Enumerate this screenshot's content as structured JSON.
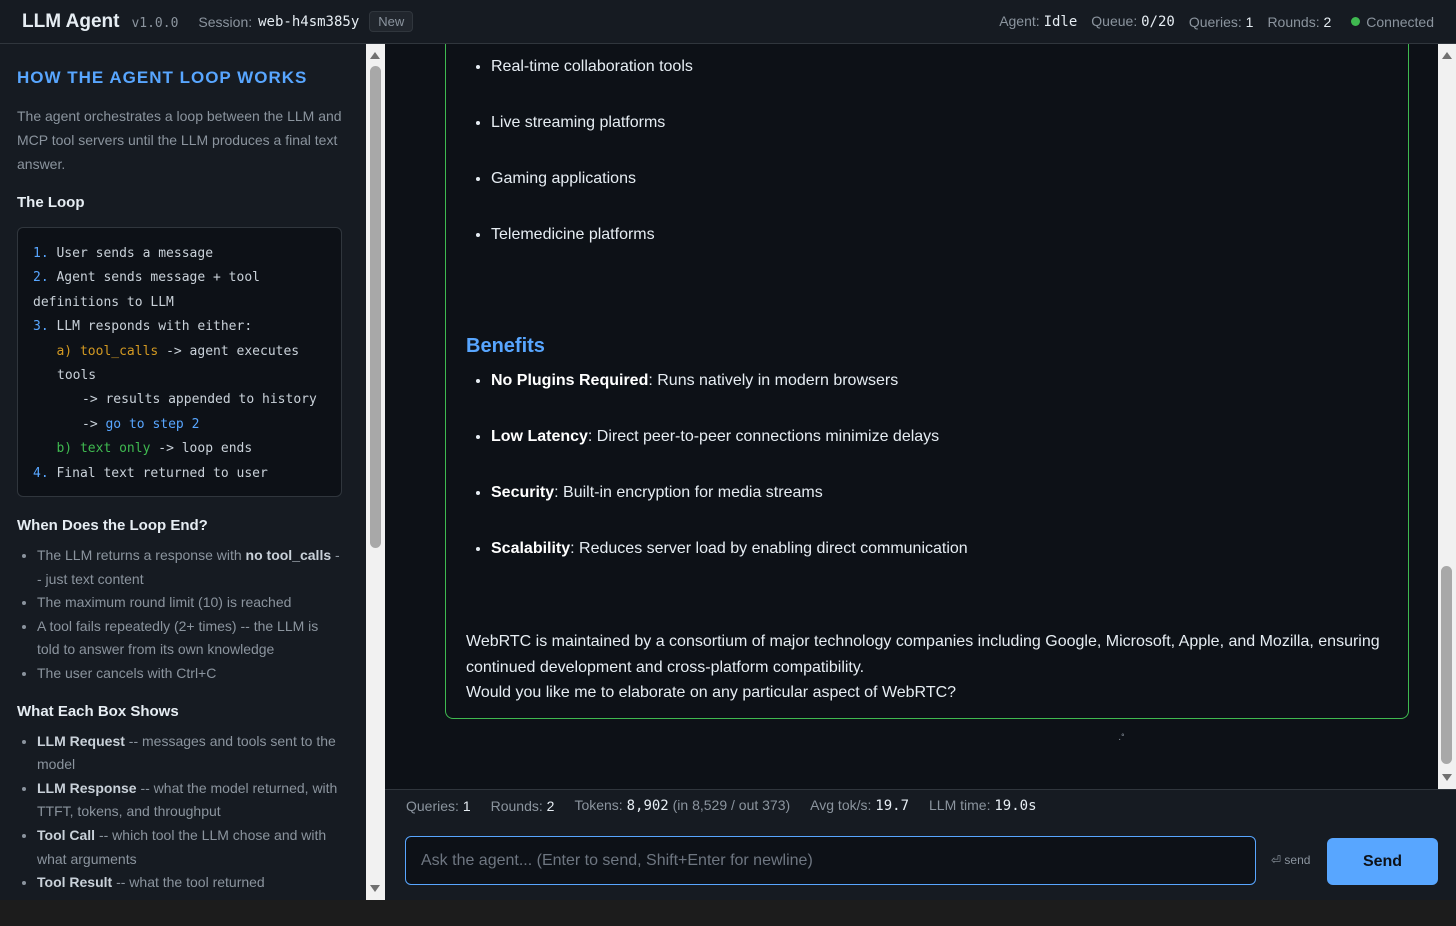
{
  "header": {
    "brand": "LLM Agent",
    "version": "v1.0.0",
    "session_label": "Session:",
    "session_id": "web-h4sm385y",
    "new_label": "New",
    "agent_label": "Agent:",
    "agent_value": "Idle",
    "queue_label": "Queue:",
    "queue_value": "0/20",
    "queries_label": "Queries:",
    "queries_value": "1",
    "rounds_label": "Rounds:",
    "rounds_value": "2",
    "connection": "Connected"
  },
  "sidebar": {
    "title": "How the Agent Loop Works",
    "intro": "The agent orchestrates a loop between the LLM and MCP tool servers until the LLM produces a final text answer.",
    "loop_heading": "The Loop",
    "code": {
      "l1_num": "1.",
      "l1": " User sends a message",
      "l2_num": "2.",
      "l2": " Agent sends message + tool definitions to LLM",
      "l3_num": "3.",
      "l3": " LLM responds with either:",
      "l4_a": "a)",
      "l4_tc": "tool_calls",
      "l4_rest": " -> agent executes tools",
      "l5": "-> results appended to history",
      "l6_arrow": "->",
      "l6_go": "go to step 2",
      "l7_b": "b)",
      "l7_text": "text only",
      "l7_rest": " -> loop ends",
      "l8_num": "4.",
      "l8": " Final text returned to user"
    },
    "end_heading": "When Does the Loop End?",
    "end_items": {
      "i1_a": "The LLM returns a response with ",
      "i1_b": "no tool_calls",
      "i1_c": " -- just text content",
      "i2": "The maximum round limit (10) is reached",
      "i3": "A tool fails repeatedly (2+ times) -- the LLM is told to answer from its own knowledge",
      "i4": "The user cancels with Ctrl+C"
    },
    "box_heading": "What Each Box Shows",
    "box_items": {
      "b1_t": "LLM Request",
      "b1_d": " -- messages and tools sent to the model",
      "b2_t": "LLM Response",
      "b2_d": " -- what the model returned, with TTFT, tokens, and throughput",
      "b3_t": "Tool Call",
      "b3_d": " -- which tool the LLM chose and with what arguments",
      "b4_t": "Tool Result",
      "b4_d": " -- what the tool returned"
    }
  },
  "message": {
    "use_cases": [
      "Real-time collaboration tools",
      "Live streaming platforms",
      "Gaming applications",
      "Telemedicine platforms"
    ],
    "benefits_heading": "Benefits",
    "benefits": [
      {
        "title": "No Plugins Required",
        "desc": ": Runs natively in modern browsers"
      },
      {
        "title": "Low Latency",
        "desc": ": Direct peer-to-peer connections minimize delays"
      },
      {
        "title": "Security",
        "desc": ": Built-in encryption for media streams"
      },
      {
        "title": "Scalability",
        "desc": ": Reduces server load by enabling direct communication"
      }
    ],
    "closing_1": "WebRTC is maintained by a consortium of major technology companies including Google, Microsoft, Apple, and Mozilla, ensuring continued development and cross-platform compatibility.",
    "closing_2": "Would you like me to elaborate on any particular aspect of WebRTC?"
  },
  "stats": {
    "queries_label": "Queries:",
    "queries_value": "1",
    "rounds_label": "Rounds:",
    "rounds_value": "2",
    "tokens_label": "Tokens:",
    "tokens_value": "8,902",
    "tokens_detail": "(in 8,529 / out 373)",
    "avg_label": "Avg tok/s:",
    "avg_value": "19.7",
    "llm_time_label": "LLM time:",
    "llm_time_value": "19.0s"
  },
  "input": {
    "placeholder": "Ask the agent... (Enter to send, Shift+Enter for newline)",
    "value": "",
    "send_hint": "⏎ send",
    "send_label": "Send"
  },
  "colors": {
    "accent": "#58a6ff",
    "success": "#3fb950",
    "warning": "#d29922",
    "background": "#0d1117",
    "panel": "#161b22"
  }
}
